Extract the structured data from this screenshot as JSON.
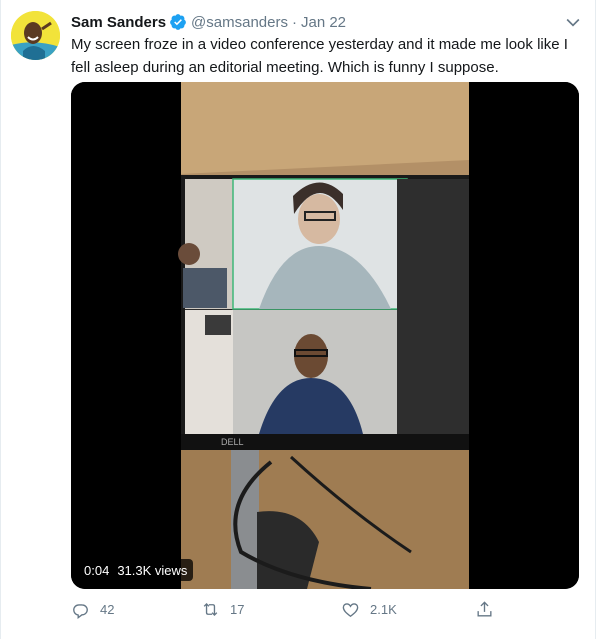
{
  "tweet": {
    "author_name": "Sam Sanders",
    "handle": "@samsanders",
    "separator": "·",
    "date": "Jan 22",
    "verified": true,
    "text": "My screen froze in a video conference yesterday and it made me look like I fell asleep during an editorial meeting. Which is funny I suppose."
  },
  "media": {
    "time": "0:04",
    "views": "31.3K views",
    "monitor_brand": "DELL"
  },
  "actions": {
    "reply_count": "42",
    "retweet_count": "17",
    "like_count": "2.1K"
  },
  "icons": {
    "reply": "reply-icon",
    "retweet": "retweet-icon",
    "like": "like-icon",
    "share": "share-icon",
    "menu": "chevron-down-icon",
    "verified": "verified-badge-icon"
  },
  "colors": {
    "accent": "#1da1f2",
    "secondary_text": "#657786",
    "primary_text": "#14171a",
    "avatar_bg": "#f2e33a"
  }
}
